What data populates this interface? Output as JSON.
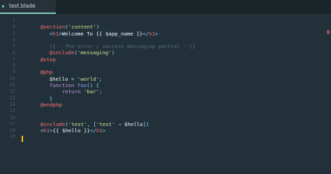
{
  "tab": {
    "label": "test.blade",
    "icon": "file-icon"
  },
  "line_numbers": [
    "1",
    "2",
    "3",
    "4",
    "5",
    "6",
    "7",
    "8",
    "9",
    "10",
    "11",
    "12",
    "13",
    "14",
    "15",
    "16",
    "17",
    "18",
    "19"
  ],
  "code": {
    "l1": {
      "a": "@section",
      "b": "(",
      "c": "'content'",
      "d": ")"
    },
    "l2": {
      "a": "<",
      "b": "h1",
      "c": ">",
      "d": "Welcome To ",
      "e": "{{ $app_name }}",
      "f": "</",
      "g": "h1",
      "h": ">"
    },
    "l4": {
      "a": "{{-- The error / success messaging partial --}}"
    },
    "l5": {
      "a": "@include",
      "b": "(",
      "c": "'messaging'",
      "d": ")"
    },
    "l6": {
      "a": "@stop"
    },
    "l8": {
      "a": "@php"
    },
    "l9": {
      "a": "$hello",
      "b": " = ",
      "c": "'world'",
      "d": ";"
    },
    "l10": {
      "a": "function",
      "b": " ",
      "c": "foo",
      "d": "() {"
    },
    "l11": {
      "a": "return",
      "b": " ",
      "c": "'bar'",
      "d": ";"
    },
    "l12": {
      "a": "}"
    },
    "l13": {
      "a": "@endphp"
    },
    "l16": {
      "a": "@include",
      "b": "(",
      "c": "'test'",
      "d": ", [",
      "e": "'test'",
      "f": " ⇒ ",
      "g": "$hello",
      "h": "])"
    },
    "l17": {
      "a": "<",
      "b": "h1",
      "c": ">",
      "d": "{{ $hello }}",
      "e": "</",
      "f": "h1",
      "g": ">"
    }
  },
  "colors": {
    "background": "#22303a",
    "directive": "#ff7373",
    "string": "#c3e88d",
    "punctuation": "#89ddff",
    "tag": "#f07178",
    "keyword": "#c792ea",
    "function": "#82aaff",
    "comment": "#546e7a",
    "cursor": "#ffcc00"
  }
}
